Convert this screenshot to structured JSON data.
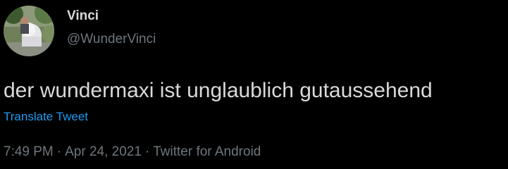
{
  "tweet": {
    "author": {
      "display_name": "Vinci",
      "handle": "@WunderVinci",
      "avatar_icon": "profile-photo-icon"
    },
    "text": "der wundermaxi ist unglaublich gutaussehend",
    "translate_label": "Translate Tweet",
    "meta": {
      "time": "7:49 PM",
      "separator": "·",
      "date": "Apr 24, 2021",
      "source": "Twitter for Android"
    }
  },
  "colors": {
    "background": "#000000",
    "primary_text": "#d9d9d9",
    "secondary_text": "#6e767d",
    "link": "#1d9bf0"
  }
}
